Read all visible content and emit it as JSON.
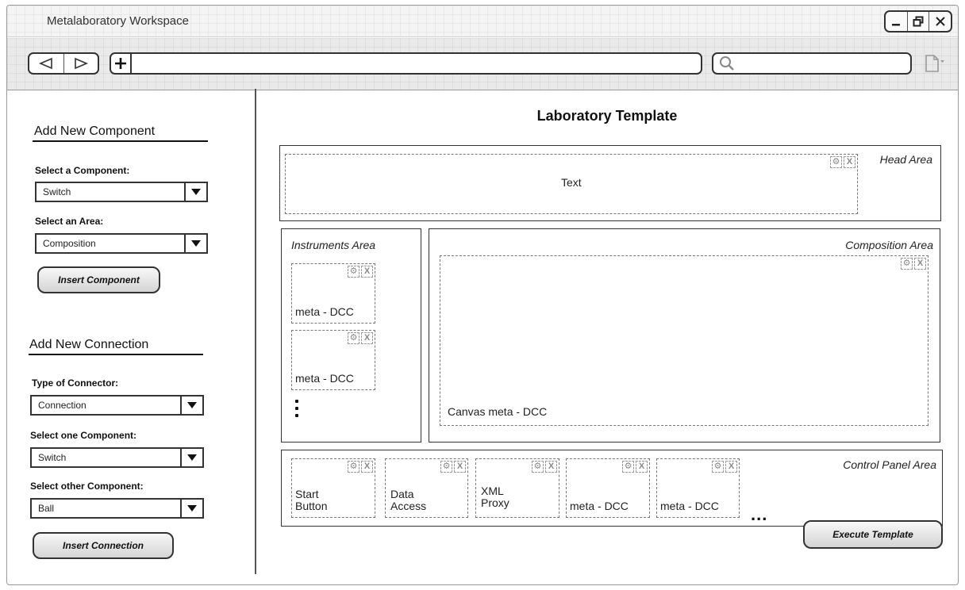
{
  "window": {
    "title": "Metalaboratory Workspace",
    "controls": {
      "minimize_icon": "minimize-icon",
      "restore_icon": "restore-icon",
      "close_icon": "close-icon"
    }
  },
  "toolbar": {
    "back_icon": "back-triangle-icon",
    "forward_icon": "forward-triangle-icon",
    "new_tab_icon": "plus-icon",
    "url_value": "",
    "search_value": "",
    "search_icon": "magnifier-icon",
    "page_menu_icon": "page-icon"
  },
  "sidebar": {
    "add_component": {
      "title": "Add New Component",
      "component_label": "Select a Component:",
      "component_value": "Switch",
      "area_label": "Select an Area:",
      "area_value": "Composition",
      "button": "Insert Component"
    },
    "add_connection": {
      "title": "Add New Connection",
      "connector_label": "Type of Connector:",
      "connector_value": "Connection",
      "one_label": "Select one Component:",
      "one_value": "Switch",
      "other_label": "Select other Component:",
      "other_value": "Ball",
      "button": "Insert Connection"
    }
  },
  "main": {
    "title": "Laboratory Template",
    "head_area": {
      "label": "Head Area",
      "content": "Text"
    },
    "instruments_area": {
      "label": "Instruments Area",
      "items": [
        "meta - DCC",
        "meta - DCC"
      ]
    },
    "composition_area": {
      "label": "Composition Area",
      "canvas": "Canvas meta - DCC"
    },
    "control_panel_area": {
      "label": "Control Panel Area",
      "items": [
        "Start\nButton",
        "Data\nAccess",
        "XML\nProxy",
        "meta - DCC",
        "meta - DCC"
      ],
      "more": "..."
    },
    "execute_button": "Execute Template"
  },
  "component_controls": {
    "settings": "⚙",
    "remove": "X"
  }
}
